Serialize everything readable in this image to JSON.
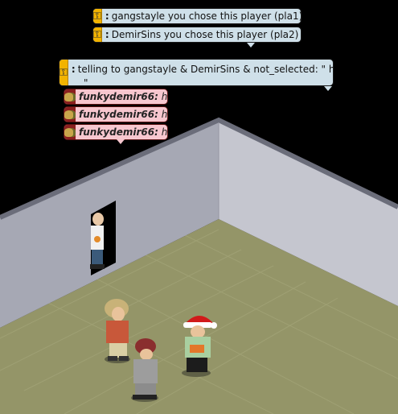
{
  "room": {
    "floor_color": "#949568",
    "floor_front_color": "#6e6e4c",
    "wall_left_color": "#a6a8b4",
    "wall_right_color": "#c5c6cf",
    "wall_top_color": "#6b6d7a"
  },
  "system_messages": [
    {
      "text": "gangstayle you chose this player (pla1)"
    },
    {
      "text": "DemirSins you chose this player (pla2)"
    },
    {
      "text": "telling to gangstayle & DemirSins & not_selected: \" hi",
      "overflow": "\""
    }
  ],
  "chat": [
    {
      "user": "funkydemir66:",
      "msg": "hi"
    },
    {
      "user": "funkydemir66:",
      "msg": "hi"
    },
    {
      "user": "funkydemir66:",
      "msg": "hi"
    }
  ],
  "icons": {
    "system": "key-icon",
    "avatar": "avatar-head-icon"
  }
}
